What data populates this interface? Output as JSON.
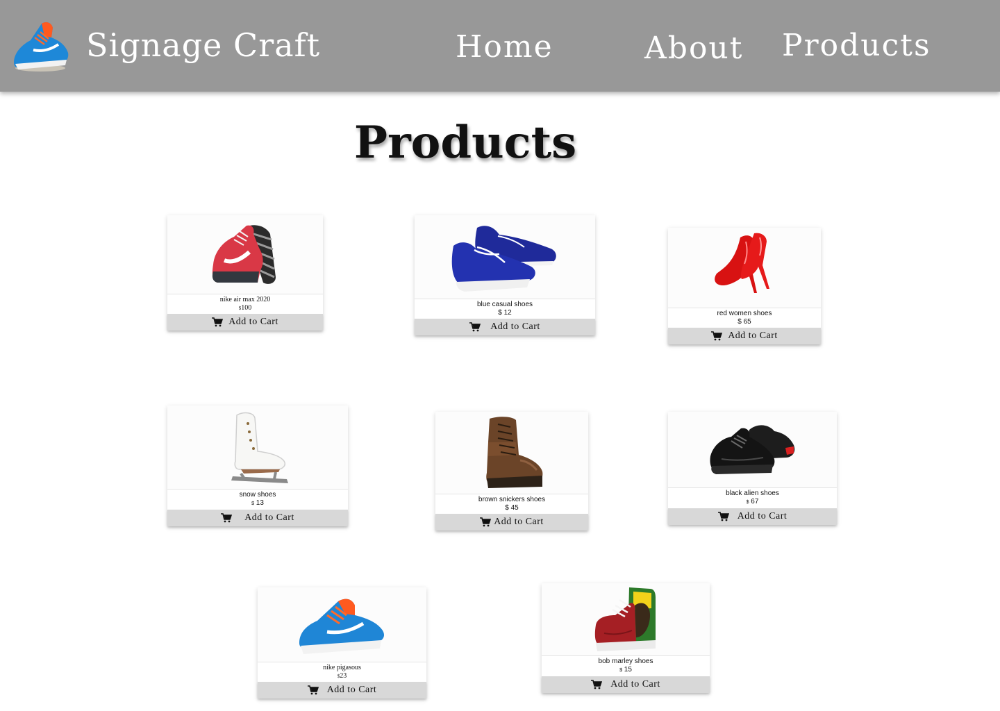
{
  "header": {
    "brand": "Signage Craft",
    "logo_icon": "sneaker-logo-icon",
    "nav": [
      {
        "label": "Home"
      },
      {
        "label": "About"
      },
      {
        "label": "Products"
      }
    ],
    "background": "#989898"
  },
  "page": {
    "title": "Products"
  },
  "cart_icon": "cart-icon",
  "products": [
    {
      "name": "nike air max 2020",
      "currency": "$",
      "price": "100",
      "button": "Add to Cart",
      "image_icon": "red-running-shoe-icon"
    },
    {
      "name": "blue casual shoes",
      "currency": "$",
      "price": "12",
      "button": "Add to Cart",
      "image_icon": "blue-boat-shoe-icon"
    },
    {
      "name": "red women shoes",
      "currency": "$",
      "price": "65",
      "button": "Add to Cart",
      "image_icon": "red-high-heel-icon"
    },
    {
      "name": "snow shoes",
      "currency": "$",
      "price": "13",
      "button": "Add to Cart",
      "image_icon": "ice-skate-icon"
    },
    {
      "name": "brown snickers shoes",
      "currency": "$",
      "price": "45",
      "button": "Add to Cart",
      "image_icon": "brown-boot-icon"
    },
    {
      "name": "black alien shoes",
      "currency": "$",
      "price": "67",
      "button": "Add to Cart",
      "image_icon": "black-sneaker-icon"
    },
    {
      "name": "nike pigasous",
      "currency": "$",
      "price": "23",
      "button": "Add to Cart",
      "image_icon": "blue-running-shoe-icon"
    },
    {
      "name": "bob marley shoes",
      "currency": "$",
      "price": "15",
      "button": "Add to Cart",
      "image_icon": "red-high-top-icon"
    }
  ]
}
